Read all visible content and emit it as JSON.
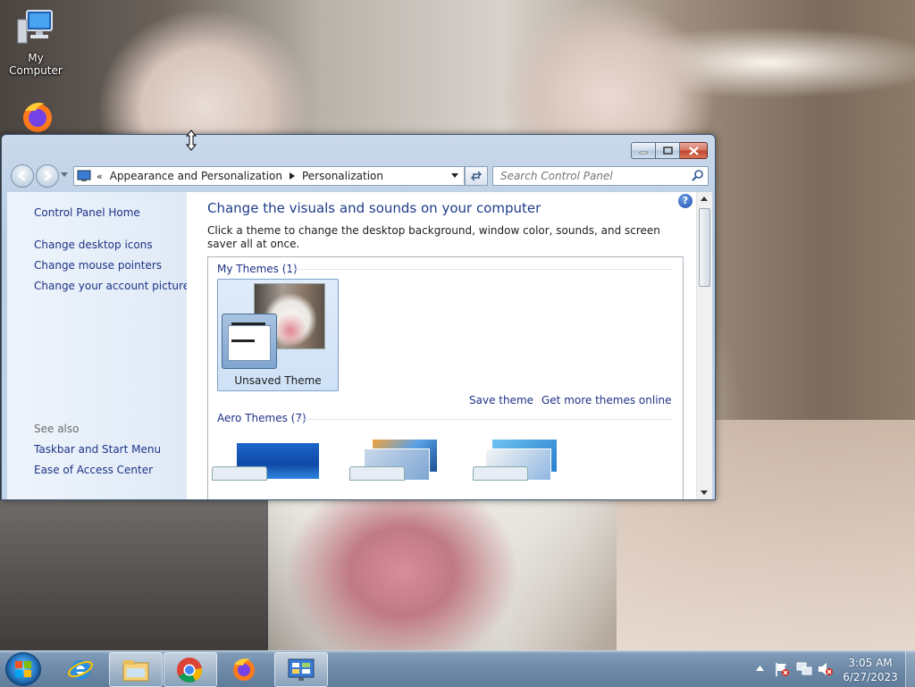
{
  "desktop": {
    "icons": [
      {
        "label": "My Computer",
        "icon": "computer-icon"
      },
      {
        "label": "",
        "icon": "firefox-icon"
      }
    ]
  },
  "window": {
    "caption_buttons": {
      "minimize": "minimize-icon",
      "maximize": "maximize-icon",
      "close": "close-icon"
    },
    "address": {
      "overflow": "«",
      "crumbs": [
        "Appearance and Personalization",
        "Personalization"
      ]
    },
    "search": {
      "placeholder": "Search Control Panel"
    },
    "left_pane": {
      "home": "Control Panel Home",
      "links": [
        "Change desktop icons",
        "Change mouse pointers",
        "Change your account picture"
      ],
      "see_also_label": "See also",
      "see_also": [
        "Taskbar and Start Menu",
        "Ease of Access Center"
      ]
    },
    "main": {
      "heading": "Change the visuals and sounds on your computer",
      "description": "Click a theme to change the desktop background, window color, sounds, and screen saver all at once.",
      "help": "?",
      "my_themes_label": "My Themes (1)",
      "unsaved_theme": "Unsaved Theme",
      "save_theme": "Save theme",
      "get_more": "Get more themes online",
      "aero_label": "Aero Themes (7)"
    }
  },
  "taskbar": {
    "apps": [
      "internet-explorer-icon",
      "file-explorer-icon",
      "chrome-icon",
      "firefox-icon",
      "control-panel-icon"
    ],
    "clock": {
      "time": "3:05 AM",
      "date": "6/27/2023"
    }
  },
  "colors": {
    "link": "#1e3287",
    "heading": "#1e3c8c",
    "selected_tile": "#cfe1f6"
  }
}
